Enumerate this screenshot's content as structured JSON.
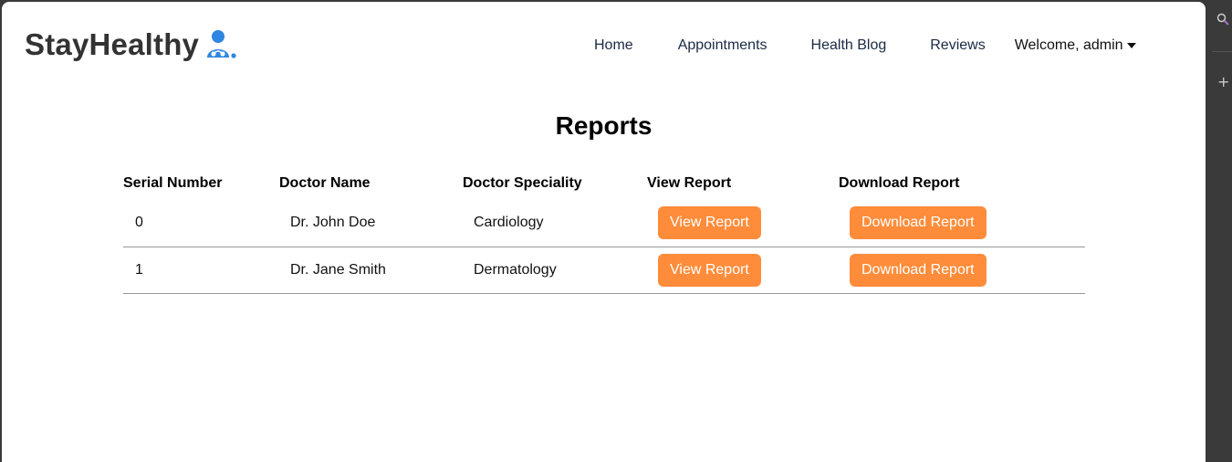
{
  "brand": {
    "name": "StayHealthy",
    "icon": "doctor-icon",
    "icon_color": "#2f86e0"
  },
  "nav": {
    "home": "Home",
    "appointments": "Appointments",
    "blog": "Health Blog",
    "reviews": "Reviews",
    "welcome": "Welcome, admin"
  },
  "page": {
    "title": "Reports"
  },
  "table": {
    "headers": [
      "Serial Number",
      "Doctor Name",
      "Doctor Speciality",
      "View Report",
      "Download Report"
    ],
    "rows": [
      {
        "serial": "0",
        "doctor": "Dr. John Doe",
        "speciality": "Cardiology",
        "view": "View Report",
        "download": "Download Report"
      },
      {
        "serial": "1",
        "doctor": "Dr. Jane Smith",
        "speciality": "Dermatology",
        "view": "View Report",
        "download": "Download Report"
      }
    ]
  },
  "colors": {
    "accent": "#ff8c3a",
    "background": "#ffffff",
    "chrome": "#3a3a3a"
  },
  "side_icons": {
    "search": "search-icon",
    "add": "plus-icon"
  }
}
